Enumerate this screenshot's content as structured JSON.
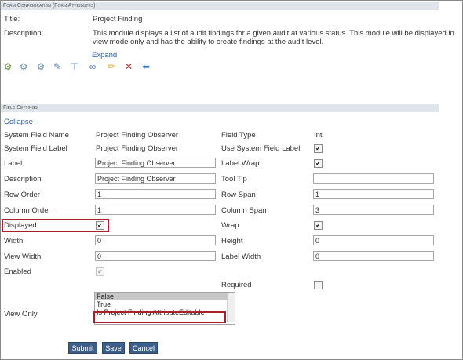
{
  "form_config": {
    "header": "Form Configuration (Form Attributes)",
    "title_label": "Title:",
    "title_value": "Project Finding",
    "description_label": "Description:",
    "description_line1": "This module displays a list of audit findings for a given audit at various status. This module will be displayed in",
    "description_line2": "view mode only and has the ability to create findings at the audit level.",
    "expand_link": "Expand"
  },
  "toolbar": {
    "icons": [
      "gear-add-icon",
      "gear-icon",
      "gear-alt-icon",
      "edit-check-icon",
      "tool-icon",
      "link-icon",
      "pencil-icon",
      "delete-x-icon",
      "back-arrow-icon"
    ]
  },
  "field_settings": {
    "header": "Field Settings",
    "collapse_link": "Collapse",
    "system_field_name_label": "System Field Name",
    "system_field_name_value": "Project Finding Observer",
    "field_type_label": "Field Type",
    "field_type_value": "Int",
    "system_field_label_label": "System Field Label",
    "system_field_label_value": "Project Finding Observer",
    "use_system_field_label": "Use System Field Label",
    "label_label": "Label",
    "label_value": "Project Finding Observer",
    "label_wrap_label": "Label Wrap",
    "description_label": "Description",
    "description_value": "Project Finding Observer",
    "tool_tip_label": "Tool Tip",
    "tool_tip_value": "",
    "row_order_label": "Row Order",
    "row_order_value": "1",
    "row_span_label": "Row Span",
    "row_span_value": "1",
    "column_order_label": "Column Order",
    "column_order_value": "1",
    "column_span_label": "Column Span",
    "column_span_value": "3",
    "displayed_label": "Displayed",
    "wrap_label": "Wrap",
    "width_label": "Width",
    "width_value": "0",
    "height_label": "Height",
    "height_value": "0",
    "view_width_label": "View Width",
    "view_width_value": "0",
    "label_width_label": "Label Width",
    "label_width_value": "0",
    "enabled_label": "Enabled",
    "required_label": "Required",
    "view_only_label": "View Only",
    "view_only_options": [
      "False",
      "True",
      "Is Project Finding AttributeEditable"
    ],
    "view_only_selected": "False",
    "checks": {
      "use_system_field_label": true,
      "label_wrap": true,
      "displayed": true,
      "wrap": true,
      "enabled": true,
      "required": false
    }
  },
  "buttons": {
    "submit": "Submit",
    "save": "Save",
    "cancel": "Cancel"
  },
  "colors": {
    "section_bar": "#dfe5ea",
    "link": "#2a5da8",
    "button": "#3d5f87",
    "highlight_border": "#a8202e"
  }
}
